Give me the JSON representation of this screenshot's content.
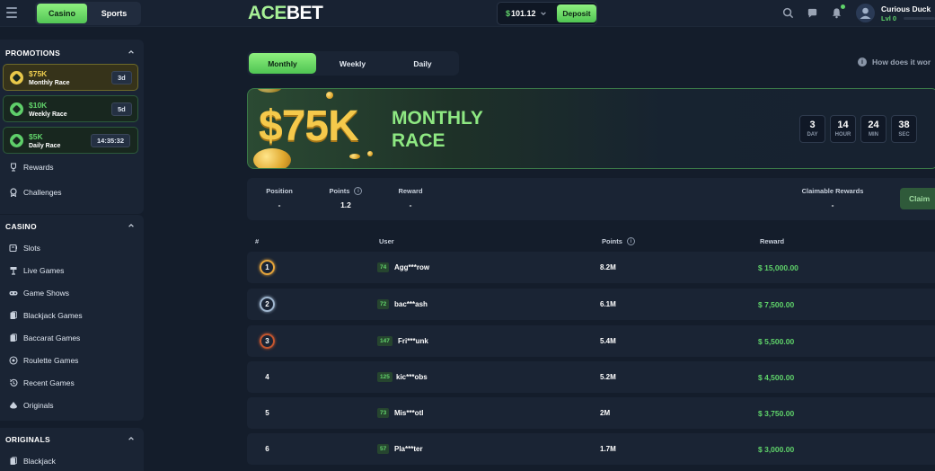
{
  "topbar": {
    "mode_tabs": [
      "Casino",
      "Sports"
    ],
    "logo": {
      "prefix": "ACE",
      "suffix": "BET"
    },
    "wallet": {
      "currency_symbol": "$",
      "balance": "101.12"
    },
    "deposit_label": "Deposit",
    "user": {
      "name": "Curious Duck",
      "level": "Lvl 0"
    },
    "accent_color": "#62d46b"
  },
  "sidebar": {
    "promotions": {
      "title": "PROMOTIONS",
      "races": [
        {
          "amount": "$75K",
          "name": "Monthly Race",
          "badge": "3d"
        },
        {
          "amount": "$10K",
          "name": "Weekly Race",
          "badge": "5d"
        },
        {
          "amount": "$5K",
          "name": "Daily Race",
          "badge": "14:35:32"
        }
      ],
      "items": [
        {
          "label": "Rewards",
          "icon": "trophy-icon"
        },
        {
          "label": "Challenges",
          "icon": "challenge-icon"
        }
      ]
    },
    "casino": {
      "title": "CASINO",
      "items": [
        {
          "label": "Slots",
          "icon": "slots-icon"
        },
        {
          "label": "Live Games",
          "icon": "live-games-icon"
        },
        {
          "label": "Game Shows",
          "icon": "game-shows-icon"
        },
        {
          "label": "Blackjack Games",
          "icon": "blackjack-icon"
        },
        {
          "label": "Baccarat Games",
          "icon": "baccarat-icon"
        },
        {
          "label": "Roulette Games",
          "icon": "roulette-icon"
        },
        {
          "label": "Recent Games",
          "icon": "recent-icon"
        },
        {
          "label": "Originals",
          "icon": "originals-icon"
        }
      ]
    },
    "originals": {
      "title": "ORIGINALS",
      "items": [
        {
          "label": "Blackjack",
          "icon": "blackjack-icon"
        }
      ]
    }
  },
  "main": {
    "tabs": [
      "Monthly",
      "Weekly",
      "Daily"
    ],
    "how_link": "How does it wor",
    "banner": {
      "amount": "$75K",
      "title_line1": "MONTHLY",
      "title_line2": "RACE",
      "countdown": [
        {
          "value": "3",
          "unit": "DAY"
        },
        {
          "value": "14",
          "unit": "HOUR"
        },
        {
          "value": "24",
          "unit": "MIN"
        },
        {
          "value": "38",
          "unit": "SEC"
        }
      ]
    },
    "stats": {
      "position": {
        "label": "Position",
        "value": "-"
      },
      "points": {
        "label": "Points",
        "value": "1.2"
      },
      "reward": {
        "label": "Reward",
        "value": "-"
      },
      "claimable": {
        "label": "Claimable Rewards",
        "value": "-"
      },
      "claim_label": "Claim"
    },
    "leaderboard": {
      "headers": {
        "rank": "#",
        "user": "User",
        "points": "Points",
        "reward": "Reward"
      },
      "rows": [
        {
          "rank": "1",
          "level": "74",
          "user": "Agg***row",
          "points": "8.2M",
          "reward": "$ 15,000.00"
        },
        {
          "rank": "2",
          "level": "72",
          "user": "bac***ash",
          "points": "6.1M",
          "reward": "$ 7,500.00"
        },
        {
          "rank": "3",
          "level": "147",
          "user": "Fri***unk",
          "points": "5.4M",
          "reward": "$ 5,500.00"
        },
        {
          "rank": "4",
          "level": "125",
          "user": "kic***obs",
          "points": "5.2M",
          "reward": "$ 4,500.00"
        },
        {
          "rank": "5",
          "level": "73",
          "user": "Mis***otl",
          "points": "2M",
          "reward": "$ 3,750.00"
        },
        {
          "rank": "6",
          "level": "57",
          "user": "Pla***ter",
          "points": "1.7M",
          "reward": "$ 3,000.00"
        }
      ]
    }
  }
}
